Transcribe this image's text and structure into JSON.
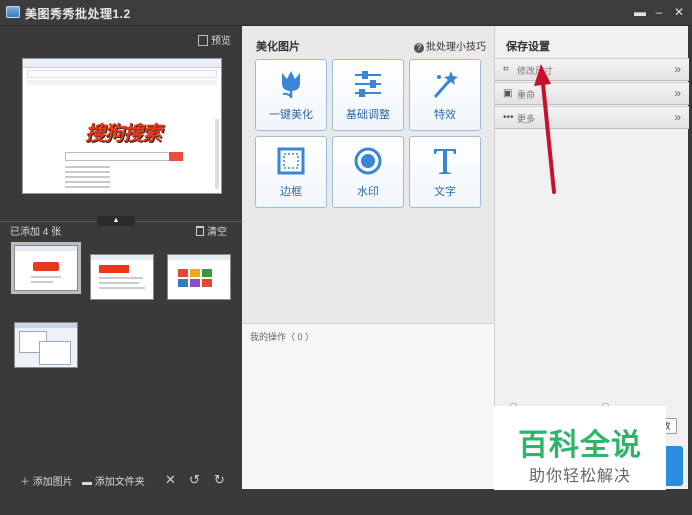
{
  "window": {
    "title": "美图秀秀批处理1.2"
  },
  "left": {
    "preview_label": "预览",
    "added_count": "已添加 4 张",
    "clear_label": "清空",
    "preview_logo": "搜狗搜索",
    "bottom": {
      "add_images": "添加图片",
      "add_folder": "添加文件夹"
    }
  },
  "middle": {
    "title": "美化图片",
    "tips_link": "批处理小技巧",
    "tools": [
      {
        "label": "一键美化",
        "icon": "tulip-icon"
      },
      {
        "label": "基础调整",
        "icon": "sliders-icon"
      },
      {
        "label": "特效",
        "icon": "magic-wand-icon"
      },
      {
        "label": "边框",
        "icon": "frame-icon"
      },
      {
        "label": "水印",
        "icon": "watermark-icon"
      },
      {
        "label": "文字",
        "icon": "text-icon"
      }
    ],
    "ops_title": "我的操作（ 0 ）"
  },
  "right": {
    "title": "保存设置",
    "rows": [
      {
        "label": "修改尺寸",
        "icon": "crop-icon"
      },
      {
        "label": "重命",
        "icon": "rename-icon"
      },
      {
        "label": "更多",
        "icon": "more-icon"
      }
    ],
    "button_stub": "改"
  },
  "watermark": {
    "title": "百科全说",
    "subtitle": "助你轻松解决"
  },
  "colors": {
    "accent_blue": "#2c6aa5",
    "annotation_red": "#c8102e",
    "watermark_green": "#2db56a"
  }
}
